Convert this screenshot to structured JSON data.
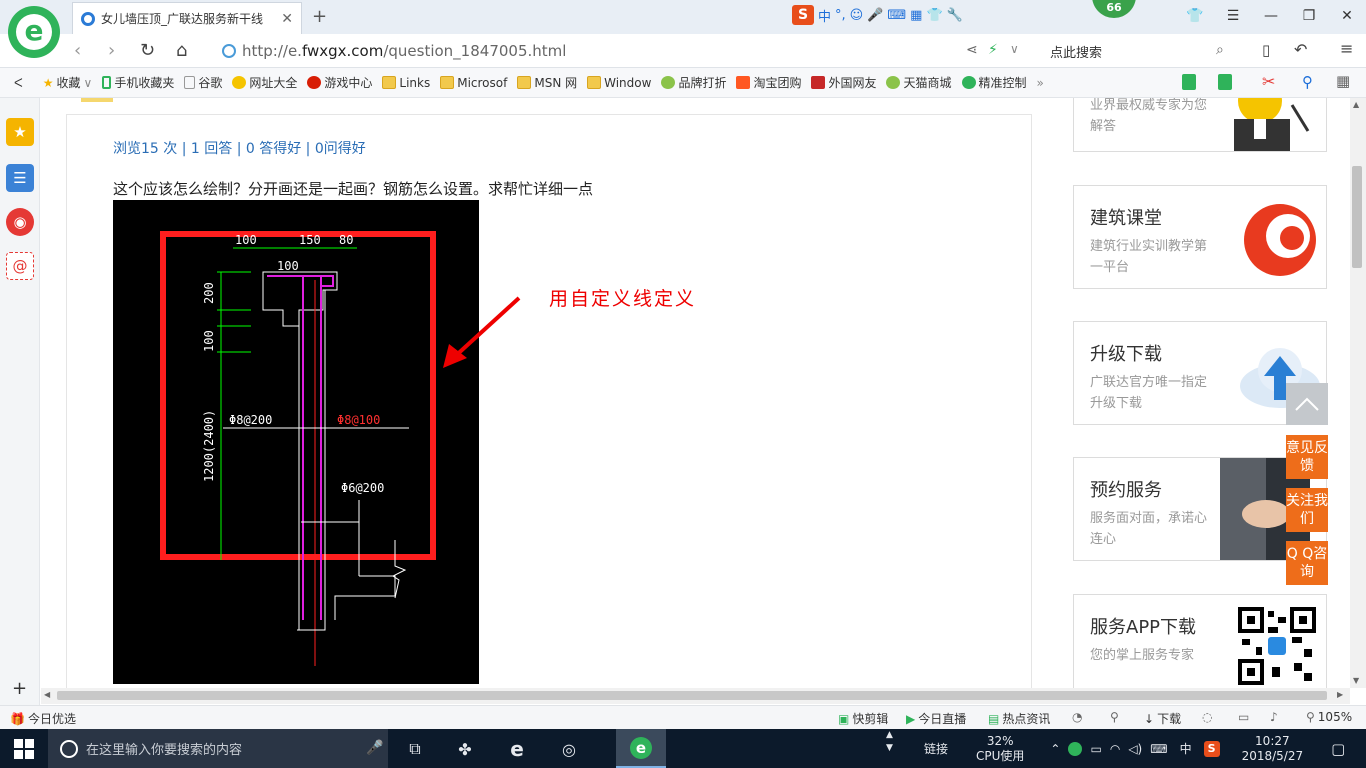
{
  "browser": {
    "tab_title": "女儿墙压顶_广联达服务新干线",
    "tab_close": "✕",
    "new_tab": "+",
    "badge_count": "66",
    "sogou_label": "中",
    "url_prefix": "http://e.",
    "url_domain": "fwxgx.com",
    "url_path": "/question_1847005.html",
    "search_placeholder": "点此搜索"
  },
  "bookmarks": [
    {
      "label": "收藏",
      "icon": "star-icon"
    },
    {
      "label": "手机收藏夹",
      "icon": "phone-icon"
    },
    {
      "label": "谷歌",
      "icon": "page-icon"
    },
    {
      "label": "网址大全",
      "icon": "globe-icon"
    },
    {
      "label": "游戏中心",
      "icon": "game-icon"
    },
    {
      "label": "Links",
      "icon": "folder-icon"
    },
    {
      "label": "Microsof",
      "icon": "folder-icon"
    },
    {
      "label": "MSN 网",
      "icon": "folder-icon"
    },
    {
      "label": "Window",
      "icon": "folder-icon"
    },
    {
      "label": "品牌打折",
      "icon": "leaf-icon"
    },
    {
      "label": "淘宝团购",
      "icon": "taobao-icon"
    },
    {
      "label": "外国网友",
      "icon": "flag-icon"
    },
    {
      "label": "天猫商城",
      "icon": "leaf-icon"
    },
    {
      "label": "精准控制",
      "icon": "chat-icon"
    }
  ],
  "question": {
    "stats": "浏览15 次 | 1 回答 | 0 答得好 | 0问得好",
    "text": "这个应该怎么绘制？分开画还是一起画？钢筋怎么设置。求帮忙详细一点",
    "annotation": "用自定义线定义"
  },
  "cad": {
    "dim_top": [
      "100",
      "150",
      "80"
    ],
    "dim_100": "100",
    "dim_left": [
      "200",
      "100",
      "1200(2400)"
    ],
    "rebar_left": "Φ8@200",
    "rebar_right": "Φ8@100",
    "rebar_lower": "Φ6@200"
  },
  "sidebar": {
    "expert_text": "业界最权威专家为您解答",
    "cards": [
      {
        "title": "建筑课堂",
        "sub": "建筑行业实训教学第一平台"
      },
      {
        "title": "升级下载",
        "sub": "广联达官方唯一指定升级下载"
      },
      {
        "title": "预约服务",
        "sub": "服务面对面，承诺心连心"
      },
      {
        "title": "服务APP下载",
        "sub": "您的掌上服务专家"
      }
    ],
    "float_buttons": [
      "意见反馈",
      "关注我们",
      "Q Q咨询"
    ]
  },
  "statusbar": {
    "left": "今日优选",
    "items": [
      "快剪辑",
      "今日直播",
      "热点资讯",
      "下载"
    ],
    "zoom": "105%"
  },
  "taskbar": {
    "search_placeholder": "在这里输入你要搜索的内容",
    "link_label": "链接",
    "cpu_percent": "32%",
    "cpu_label": "CPU使用",
    "ime": "中",
    "time": "10:27",
    "date": "2018/5/27"
  },
  "colors": {
    "accent_green": "#2fb35a",
    "link_blue": "#2a6db5",
    "annot_red": "#ee0000",
    "orange": "#ee6d1a"
  }
}
